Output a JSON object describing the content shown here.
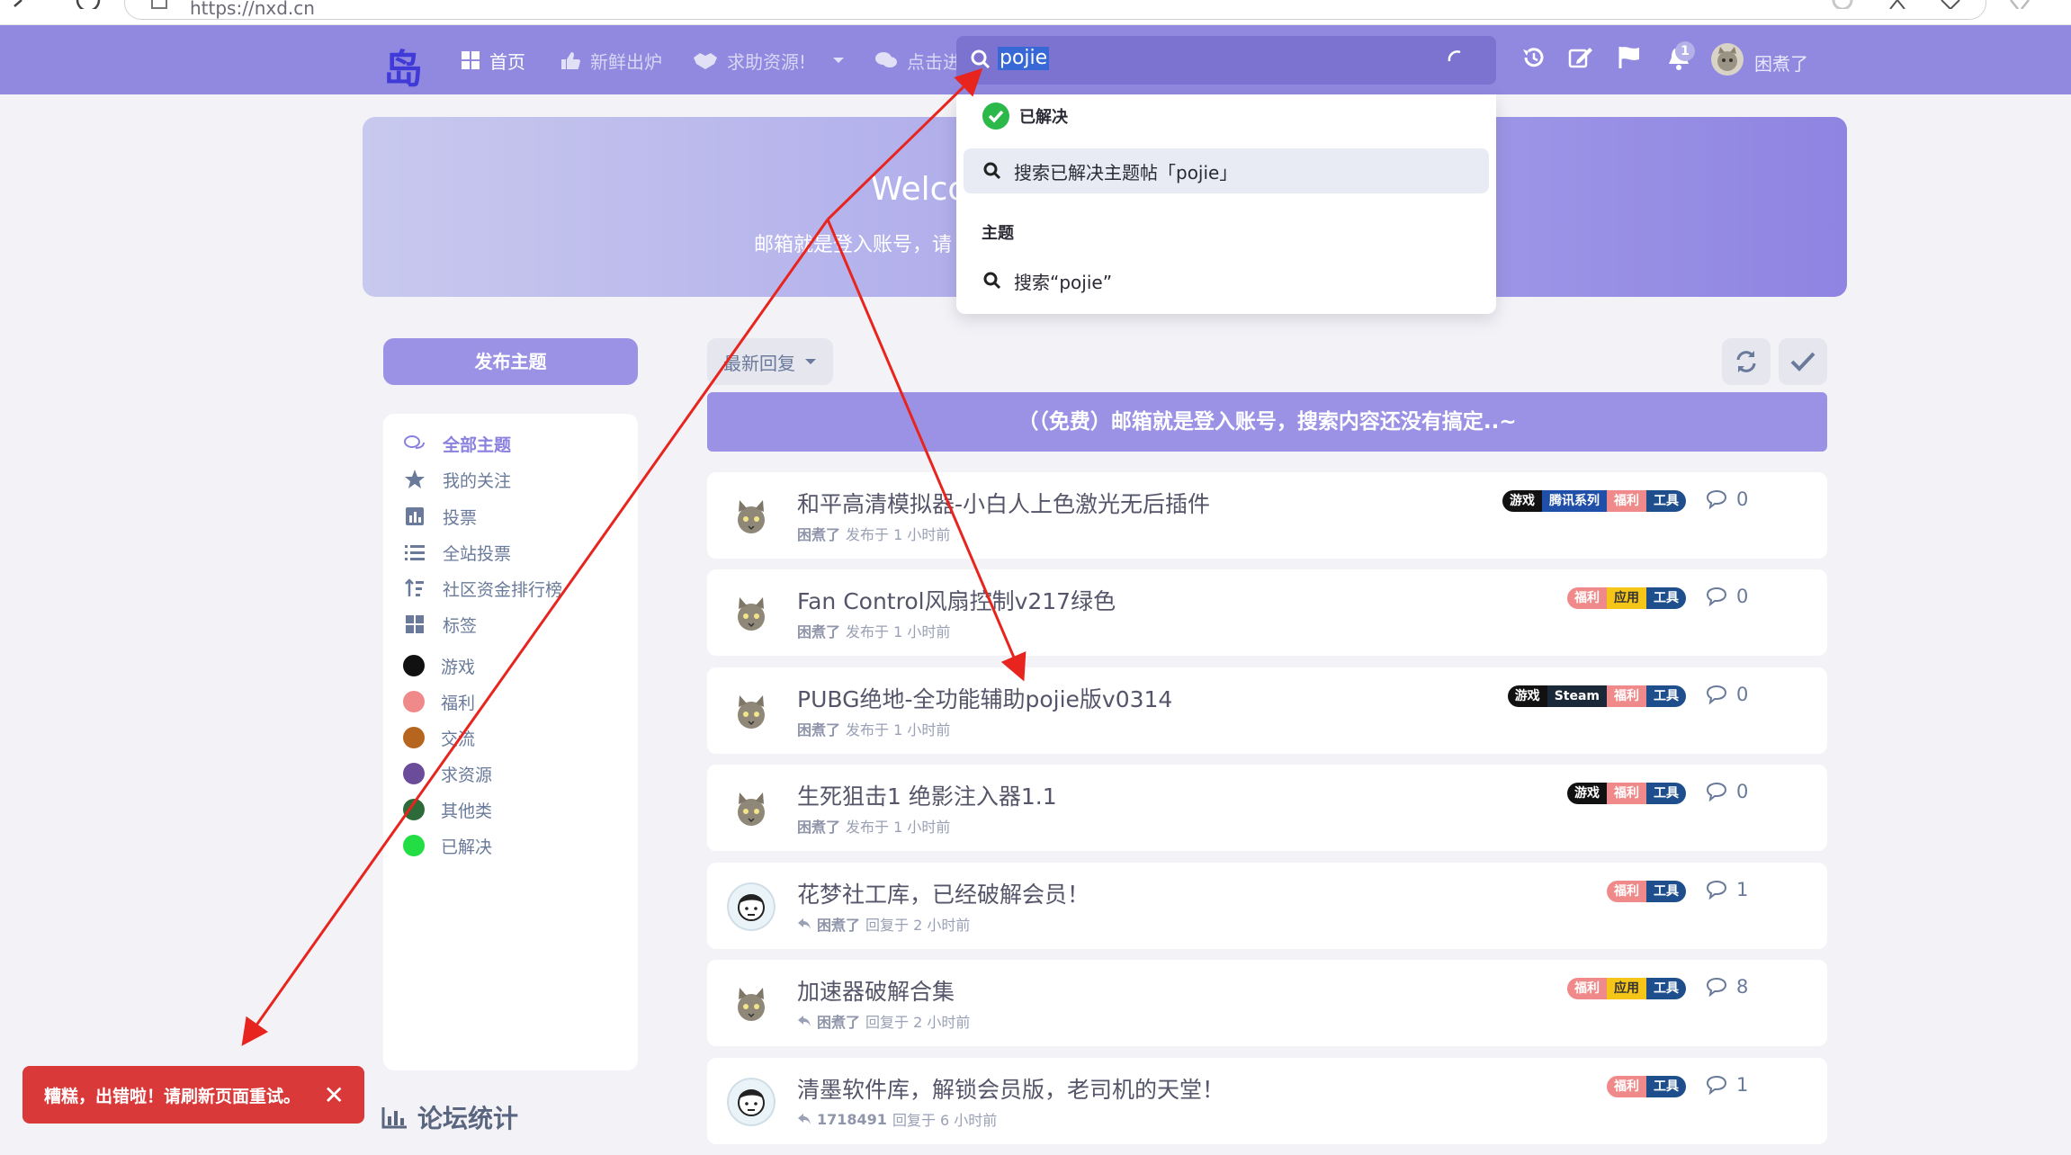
{
  "browser": {
    "url": "https://nxd.cn"
  },
  "header": {
    "logo": "岛",
    "nav": [
      {
        "label": "首页",
        "icon": "grid-icon"
      },
      {
        "label": "新鲜出炉",
        "icon": "thumbs-up-icon"
      },
      {
        "label": "求助资源!",
        "icon": "handshake-icon"
      },
      {
        "label": "点击进",
        "icon": "comments-icon"
      }
    ],
    "search": {
      "value": "pojie"
    },
    "notification_count": "1",
    "username": "困煮了"
  },
  "hero": {
    "title": "Welco",
    "subtitle": "邮箱就是登入账号，请"
  },
  "search_dropdown": {
    "section_solved": "已解决",
    "item_solved": "搜索已解决主题帖「pojie」",
    "section_topics": "主题",
    "item_topics": "搜索“pojie”"
  },
  "sidebar": {
    "post_button": "发布主题",
    "items": [
      {
        "label": "全部主题",
        "icon": "comments-icon"
      },
      {
        "label": "我的关注",
        "icon": "star-icon"
      },
      {
        "label": "投票",
        "icon": "bar-chart-icon"
      },
      {
        "label": "全站投票",
        "icon": "list-icon"
      },
      {
        "label": "社区资金排行榜",
        "icon": "sort-icon"
      },
      {
        "label": "标签",
        "icon": "tags-grid-icon"
      }
    ],
    "tags": [
      {
        "label": "游戏",
        "color": "#111111"
      },
      {
        "label": "福利",
        "color": "#f08a8a"
      },
      {
        "label": "交流",
        "color": "#b5651d"
      },
      {
        "label": "求资源",
        "color": "#6b4c9a"
      },
      {
        "label": "其他类",
        "color": "#2e6b3a"
      },
      {
        "label": "已解决",
        "color": "#22dd44"
      }
    ],
    "stats_title": "论坛统计"
  },
  "toolbar": {
    "sort_label": "最新回复"
  },
  "banner": "（（免费）邮箱就是登入账号，搜索内容还没有搞定..~",
  "topics": [
    {
      "title": "和平高清模拟器-小白人上色激光无后插件",
      "user": "困煮了",
      "action": "发布于 1 小时前",
      "replies": "0",
      "reply_icon": false,
      "tags": [
        {
          "label": "游戏",
          "color": "#111111"
        },
        {
          "label": "腾讯系列",
          "color": "#1f4fa8"
        },
        {
          "label": "福利",
          "color": "#f08a8a"
        },
        {
          "label": "工具",
          "color": "#1e4e8c"
        }
      ]
    },
    {
      "title": "Fan Control风扇控制v217绿色",
      "user": "困煮了",
      "action": "发布于 1 小时前",
      "replies": "0",
      "reply_icon": false,
      "tags": [
        {
          "label": "福利",
          "color": "#f08a8a"
        },
        {
          "label": "应用",
          "color": "#f5c518"
        },
        {
          "label": "工具",
          "color": "#1e4e8c"
        }
      ]
    },
    {
      "title": "PUBG绝地-全功能辅助pojie版v0314",
      "user": "困煮了",
      "action": "发布于 1 小时前",
      "replies": "0",
      "reply_icon": false,
      "tags": [
        {
          "label": "游戏",
          "color": "#111111"
        },
        {
          "label": "Steam",
          "color": "#1b2838"
        },
        {
          "label": "福利",
          "color": "#f08a8a"
        },
        {
          "label": "工具",
          "color": "#1e4e8c"
        }
      ]
    },
    {
      "title": "生死狙击1 绝影注入器1.1",
      "user": "困煮了",
      "action": "发布于 1 小时前",
      "replies": "0",
      "reply_icon": false,
      "tags": [
        {
          "label": "游戏",
          "color": "#111111"
        },
        {
          "label": "福利",
          "color": "#f08a8a"
        },
        {
          "label": "工具",
          "color": "#1e4e8c"
        }
      ]
    },
    {
      "title": "花梦社工库，已经破解会员！",
      "user": "困煮了",
      "action": "回复于 2 小时前",
      "replies": "1",
      "reply_icon": true,
      "tags": [
        {
          "label": "福利",
          "color": "#f08a8a"
        },
        {
          "label": "工具",
          "color": "#1e4e8c"
        }
      ]
    },
    {
      "title": "加速器破解合集",
      "user": "困煮了",
      "action": "回复于 2 小时前",
      "replies": "8",
      "reply_icon": true,
      "tags": [
        {
          "label": "福利",
          "color": "#f08a8a"
        },
        {
          "label": "应用",
          "color": "#f5c518"
        },
        {
          "label": "工具",
          "color": "#1e4e8c"
        }
      ]
    },
    {
      "title": "清墨软件库，解锁会员版，老司机的天堂！",
      "user": "1718491",
      "action": "回复于 6 小时前",
      "replies": "1",
      "reply_icon": true,
      "tags": [
        {
          "label": "福利",
          "color": "#f08a8a"
        },
        {
          "label": "工具",
          "color": "#1e4e8c"
        }
      ]
    }
  ],
  "toast": {
    "message": "糟糕，出错啦！请刷新页面重试。"
  }
}
